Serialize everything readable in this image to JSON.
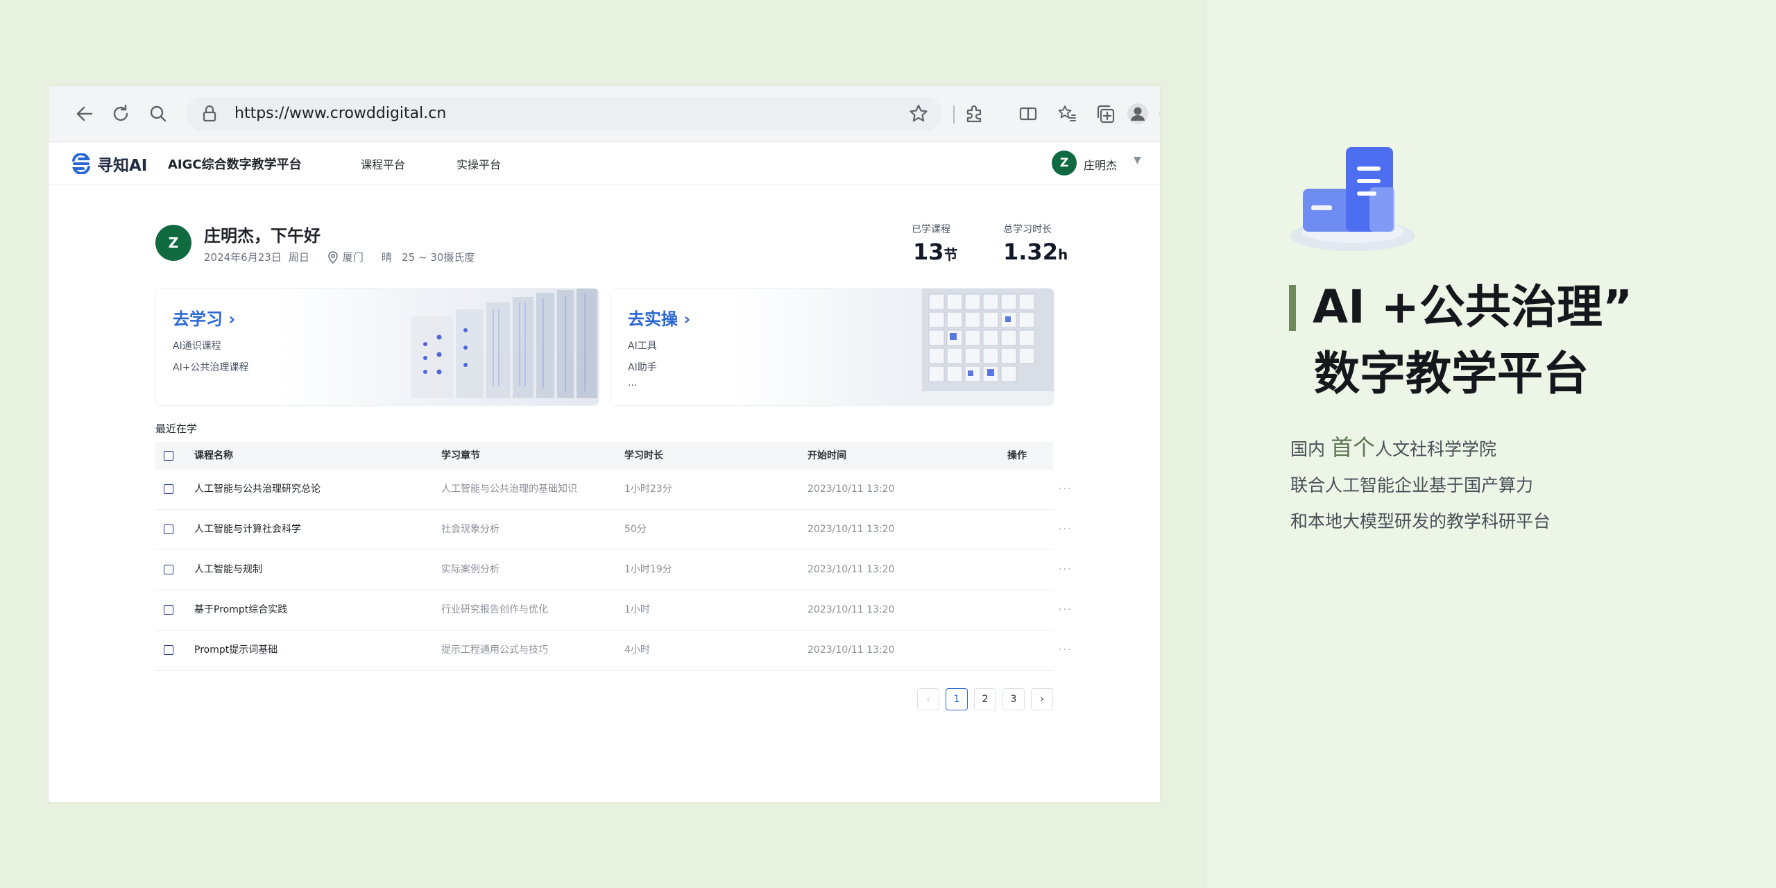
{
  "browser": {
    "url": "https://www.crowddigital.cn",
    "icons": [
      "back-arrow-icon",
      "refresh-icon",
      "search-icon",
      "lock-icon",
      "star-icon",
      "extensions-icon",
      "split-screen-icon",
      "favorites-icon",
      "collections-icon",
      "profile-icon",
      "more-icon"
    ]
  },
  "header": {
    "brand": "寻知AI",
    "platform": "AIGC综合数字教学平台",
    "nav": [
      "课程平台",
      "实操平台"
    ],
    "user_initial": "Z",
    "user_name": "庄明杰"
  },
  "greeting": {
    "initial": "Z",
    "text": "庄明杰，下午好",
    "date": "2024年6月23日",
    "weekday": "周日",
    "city": "厦门",
    "weather": "晴   25 ~ 30摄氏度"
  },
  "stats": {
    "courses_label": "已学课程",
    "courses_value": "13",
    "courses_unit": "节",
    "time_label": "总学习时长",
    "time_value": "1.32",
    "time_unit": "h"
  },
  "cards": {
    "learn": {
      "title": "去学习 ›",
      "items": [
        "AI通识课程",
        "AI+公共治理课程"
      ]
    },
    "practice": {
      "title": "去实操 ›",
      "items": [
        "AI工具",
        "AI助手",
        "..."
      ]
    }
  },
  "recent": {
    "title": "最近在学",
    "columns": [
      "课程名称",
      "学习章节",
      "学习时长",
      "开始时间",
      "操作"
    ],
    "rows": [
      {
        "name": "人工智能与公共治理研究总论",
        "chapter": "人工智能与公共治理的基础知识",
        "duration": "1小时23分",
        "start": "2023/10/11 13:20",
        "action": "···"
      },
      {
        "name": "人工智能与计算社会科学",
        "chapter": "社会现象分析",
        "duration": "50分",
        "start": "2023/10/11 13:20",
        "action": "···"
      },
      {
        "name": "人工智能与规制",
        "chapter": "实际案例分析",
        "duration": "1小时19分",
        "start": "2023/10/11 13:20",
        "action": "···"
      },
      {
        "name": "基于Prompt综合实践",
        "chapter": "行业研究报告创作与优化",
        "duration": "1小时",
        "start": "2023/10/11 13:20",
        "action": "···"
      },
      {
        "name": "Prompt提示词基础",
        "chapter": "提示工程通用公式与技巧",
        "duration": "4小时",
        "start": "2023/10/11 13:20",
        "action": "···"
      }
    ]
  },
  "pagination": {
    "prev": "‹",
    "pages": [
      "1",
      "2",
      "3"
    ],
    "next": "›",
    "current": "1"
  },
  "hero": {
    "title_line1": "AI +公共治理”",
    "title_line2": "数字教学平台",
    "desc_line1_pre": "国内 ",
    "desc_line1_em": "首个",
    "desc_line1_post": "人文社科学学院",
    "desc_line2": "联合人工智能企业基于国产算力",
    "desc_line3": "和本地大模型研发的教学科研平台"
  },
  "colors": {
    "accent": "#2a67d6",
    "avatar": "#0f6b3f",
    "background": "#e8f1df",
    "hero_bar": "#6e8a5a"
  }
}
